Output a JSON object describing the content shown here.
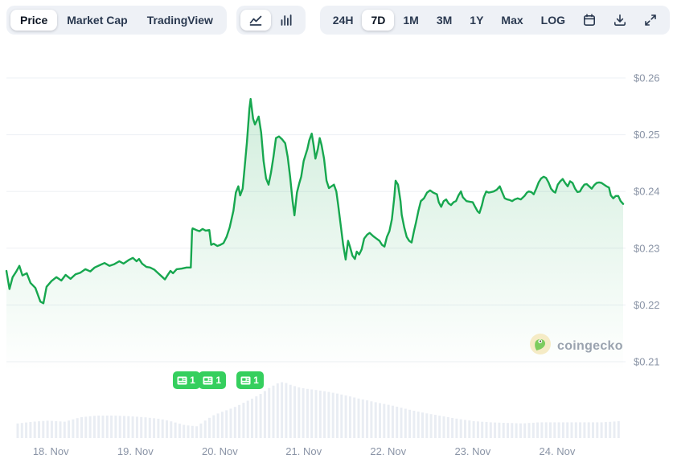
{
  "toolbar": {
    "metric_tabs": [
      {
        "label": "Price",
        "active": true
      },
      {
        "label": "Market Cap",
        "active": false
      },
      {
        "label": "TradingView",
        "active": false
      }
    ],
    "chart_type_buttons": [
      {
        "icon": "line-chart-icon",
        "active": true
      },
      {
        "icon": "bar-chart-icon",
        "active": false
      }
    ],
    "range_tabs": [
      {
        "label": "24H",
        "active": false
      },
      {
        "label": "7D",
        "active": true
      },
      {
        "label": "1M",
        "active": false
      },
      {
        "label": "3M",
        "active": false
      },
      {
        "label": "1Y",
        "active": false
      },
      {
        "label": "Max",
        "active": false
      },
      {
        "label": "LOG",
        "active": false
      }
    ],
    "action_buttons": [
      {
        "icon": "calendar-icon"
      },
      {
        "icon": "download-icon"
      },
      {
        "icon": "expand-icon"
      }
    ]
  },
  "watermark": {
    "text": "coingecko"
  },
  "news_badges": [
    {
      "count": "1",
      "x_frac": 0.287
    },
    {
      "count": "1",
      "x_frac": 0.329
    },
    {
      "count": "1",
      "x_frac": 0.39
    }
  ],
  "colors": {
    "line_green": "#17a74f",
    "area_green": "rgba(23,167,79,0.20)",
    "badge_green": "#35cf5e",
    "volume_bar": "#e9edf3",
    "grid": "#edf0f4",
    "axis_text": "#8a94a6",
    "toolbar_bg": "#eef1f6",
    "text_dark": "#16202e"
  },
  "chart_data": {
    "type": "line",
    "title": "Price (7D)",
    "currency": "USD",
    "legend": "none",
    "grid": "horizontal",
    "price_min_shown": 0.2203,
    "price_max_shown": 0.2563,
    "y_axis": {
      "ticks": [
        {
          "label": "$0.26",
          "value": 0.26
        },
        {
          "label": "$0.25",
          "value": 0.25
        },
        {
          "label": "$0.24",
          "value": 0.24
        },
        {
          "label": "$0.23",
          "value": 0.23
        },
        {
          "label": "$0.22",
          "value": 0.22
        },
        {
          "label": "$0.21",
          "value": 0.21
        }
      ]
    },
    "x_axis": {
      "ticks": [
        {
          "label": "18. Nov",
          "frac": 0.072
        },
        {
          "label": "19. Nov",
          "frac": 0.209
        },
        {
          "label": "20. Nov",
          "frac": 0.346
        },
        {
          "label": "21. Nov",
          "frac": 0.482
        },
        {
          "label": "22. Nov",
          "frac": 0.619
        },
        {
          "label": "23. Nov",
          "frac": 0.756
        },
        {
          "label": "24. Nov",
          "frac": 0.893
        }
      ]
    },
    "series": [
      {
        "name": "price_usd",
        "points": [
          [
            0.0,
            0.226
          ],
          [
            0.005,
            0.2228
          ],
          [
            0.01,
            0.2249
          ],
          [
            0.016,
            0.2259
          ],
          [
            0.021,
            0.2269
          ],
          [
            0.026,
            0.2252
          ],
          [
            0.033,
            0.2256
          ],
          [
            0.039,
            0.2239
          ],
          [
            0.047,
            0.223
          ],
          [
            0.055,
            0.2206
          ],
          [
            0.06,
            0.2203
          ],
          [
            0.065,
            0.2232
          ],
          [
            0.073,
            0.2242
          ],
          [
            0.081,
            0.2249
          ],
          [
            0.089,
            0.2243
          ],
          [
            0.096,
            0.2253
          ],
          [
            0.104,
            0.2246
          ],
          [
            0.112,
            0.2254
          ],
          [
            0.12,
            0.2257
          ],
          [
            0.128,
            0.2263
          ],
          [
            0.136,
            0.2259
          ],
          [
            0.143,
            0.2266
          ],
          [
            0.151,
            0.227
          ],
          [
            0.159,
            0.2274
          ],
          [
            0.167,
            0.2269
          ],
          [
            0.175,
            0.2272
          ],
          [
            0.183,
            0.2277
          ],
          [
            0.19,
            0.2273
          ],
          [
            0.198,
            0.2279
          ],
          [
            0.205,
            0.2283
          ],
          [
            0.211,
            0.2277
          ],
          [
            0.215,
            0.2281
          ],
          [
            0.22,
            0.2273
          ],
          [
            0.227,
            0.2267
          ],
          [
            0.233,
            0.2266
          ],
          [
            0.24,
            0.2262
          ],
          [
            0.246,
            0.2256
          ],
          [
            0.253,
            0.2249
          ],
          [
            0.257,
            0.2245
          ],
          [
            0.261,
            0.2252
          ],
          [
            0.266,
            0.226
          ],
          [
            0.27,
            0.2256
          ],
          [
            0.276,
            0.2263
          ],
          [
            0.284,
            0.2264
          ],
          [
            0.292,
            0.2266
          ],
          [
            0.299,
            0.2266
          ],
          [
            0.301,
            0.2331
          ],
          [
            0.302,
            0.2335
          ],
          [
            0.308,
            0.2332
          ],
          [
            0.313,
            0.233
          ],
          [
            0.318,
            0.2334
          ],
          [
            0.323,
            0.2331
          ],
          [
            0.329,
            0.2332
          ],
          [
            0.332,
            0.2306
          ],
          [
            0.336,
            0.2308
          ],
          [
            0.342,
            0.2304
          ],
          [
            0.347,
            0.2306
          ],
          [
            0.352,
            0.2309
          ],
          [
            0.357,
            0.232
          ],
          [
            0.362,
            0.2337
          ],
          [
            0.368,
            0.2366
          ],
          [
            0.372,
            0.2398
          ],
          [
            0.376,
            0.2409
          ],
          [
            0.379,
            0.2393
          ],
          [
            0.383,
            0.2405
          ],
          [
            0.386,
            0.244
          ],
          [
            0.39,
            0.2487
          ],
          [
            0.394,
            0.2546
          ],
          [
            0.396,
            0.2563
          ],
          [
            0.4,
            0.2528
          ],
          [
            0.403,
            0.2518
          ],
          [
            0.406,
            0.2525
          ],
          [
            0.409,
            0.2532
          ],
          [
            0.413,
            0.2504
          ],
          [
            0.417,
            0.2454
          ],
          [
            0.421,
            0.2423
          ],
          [
            0.425,
            0.2412
          ],
          [
            0.429,
            0.2433
          ],
          [
            0.433,
            0.2461
          ],
          [
            0.437,
            0.2494
          ],
          [
            0.442,
            0.2497
          ],
          [
            0.447,
            0.2492
          ],
          [
            0.452,
            0.2485
          ],
          [
            0.456,
            0.2461
          ],
          [
            0.46,
            0.2426
          ],
          [
            0.464,
            0.2383
          ],
          [
            0.467,
            0.2358
          ],
          [
            0.471,
            0.2398
          ],
          [
            0.475,
            0.2415
          ],
          [
            0.478,
            0.2426
          ],
          [
            0.482,
            0.2454
          ],
          [
            0.488,
            0.2475
          ],
          [
            0.491,
            0.249
          ],
          [
            0.495,
            0.2502
          ],
          [
            0.498,
            0.2482
          ],
          [
            0.501,
            0.2458
          ],
          [
            0.505,
            0.2475
          ],
          [
            0.508,
            0.2494
          ],
          [
            0.511,
            0.2482
          ],
          [
            0.515,
            0.2458
          ],
          [
            0.519,
            0.2419
          ],
          [
            0.523,
            0.2406
          ],
          [
            0.527,
            0.2409
          ],
          [
            0.531,
            0.2412
          ],
          [
            0.535,
            0.24
          ],
          [
            0.538,
            0.2376
          ],
          [
            0.542,
            0.2341
          ],
          [
            0.546,
            0.2306
          ],
          [
            0.55,
            0.228
          ],
          [
            0.554,
            0.2313
          ],
          [
            0.557,
            0.2303
          ],
          [
            0.561,
            0.2287
          ],
          [
            0.565,
            0.2281
          ],
          [
            0.568,
            0.2294
          ],
          [
            0.572,
            0.2289
          ],
          [
            0.576,
            0.2298
          ],
          [
            0.58,
            0.2317
          ],
          [
            0.585,
            0.2324
          ],
          [
            0.589,
            0.2327
          ],
          [
            0.595,
            0.2321
          ],
          [
            0.6,
            0.2317
          ],
          [
            0.605,
            0.2313
          ],
          [
            0.609,
            0.2306
          ],
          [
            0.613,
            0.2303
          ],
          [
            0.617,
            0.232
          ],
          [
            0.621,
            0.233
          ],
          [
            0.625,
            0.2351
          ],
          [
            0.629,
            0.239
          ],
          [
            0.631,
            0.2419
          ],
          [
            0.635,
            0.2412
          ],
          [
            0.639,
            0.2383
          ],
          [
            0.641,
            0.2359
          ],
          [
            0.645,
            0.2337
          ],
          [
            0.649,
            0.232
          ],
          [
            0.653,
            0.2313
          ],
          [
            0.657,
            0.231
          ],
          [
            0.661,
            0.2331
          ],
          [
            0.664,
            0.2345
          ],
          [
            0.668,
            0.2366
          ],
          [
            0.672,
            0.2383
          ],
          [
            0.677,
            0.2388
          ],
          [
            0.682,
            0.2398
          ],
          [
            0.687,
            0.2402
          ],
          [
            0.692,
            0.2398
          ],
          [
            0.698,
            0.2395
          ],
          [
            0.701,
            0.2381
          ],
          [
            0.705,
            0.2373
          ],
          [
            0.709,
            0.2383
          ],
          [
            0.713,
            0.2386
          ],
          [
            0.717,
            0.2379
          ],
          [
            0.721,
            0.2376
          ],
          [
            0.725,
            0.2381
          ],
          [
            0.729,
            0.2383
          ],
          [
            0.733,
            0.2393
          ],
          [
            0.737,
            0.24
          ],
          [
            0.74,
            0.239
          ],
          [
            0.746,
            0.2383
          ],
          [
            0.751,
            0.2382
          ],
          [
            0.756,
            0.2381
          ],
          [
            0.76,
            0.2373
          ],
          [
            0.764,
            0.2365
          ],
          [
            0.767,
            0.2362
          ],
          [
            0.771,
            0.2376
          ],
          [
            0.774,
            0.239
          ],
          [
            0.778,
            0.24
          ],
          [
            0.782,
            0.2398
          ],
          [
            0.786,
            0.2399
          ],
          [
            0.79,
            0.24
          ],
          [
            0.795,
            0.2403
          ],
          [
            0.8,
            0.2409
          ],
          [
            0.804,
            0.2398
          ],
          [
            0.808,
            0.2388
          ],
          [
            0.812,
            0.2386
          ],
          [
            0.816,
            0.2385
          ],
          [
            0.82,
            0.2383
          ],
          [
            0.824,
            0.2386
          ],
          [
            0.829,
            0.2388
          ],
          [
            0.834,
            0.2386
          ],
          [
            0.84,
            0.2392
          ],
          [
            0.844,
            0.2398
          ],
          [
            0.847,
            0.24
          ],
          [
            0.851,
            0.2399
          ],
          [
            0.855,
            0.2395
          ],
          [
            0.859,
            0.2405
          ],
          [
            0.863,
            0.2416
          ],
          [
            0.867,
            0.2423
          ],
          [
            0.871,
            0.2426
          ],
          [
            0.875,
            0.2424
          ],
          [
            0.879,
            0.2416
          ],
          [
            0.883,
            0.2405
          ],
          [
            0.887,
            0.24
          ],
          [
            0.89,
            0.2398
          ],
          [
            0.894,
            0.2412
          ],
          [
            0.898,
            0.2418
          ],
          [
            0.902,
            0.2422
          ],
          [
            0.906,
            0.2415
          ],
          [
            0.91,
            0.2409
          ],
          [
            0.914,
            0.2418
          ],
          [
            0.918,
            0.2415
          ],
          [
            0.922,
            0.2405
          ],
          [
            0.926,
            0.2399
          ],
          [
            0.93,
            0.24
          ],
          [
            0.933,
            0.2406
          ],
          [
            0.937,
            0.2412
          ],
          [
            0.941,
            0.2413
          ],
          [
            0.945,
            0.2409
          ],
          [
            0.949,
            0.2405
          ],
          [
            0.953,
            0.2411
          ],
          [
            0.957,
            0.2415
          ],
          [
            0.961,
            0.2416
          ],
          [
            0.965,
            0.2415
          ],
          [
            0.969,
            0.2412
          ],
          [
            0.973,
            0.2409
          ],
          [
            0.977,
            0.2407
          ],
          [
            0.98,
            0.2393
          ],
          [
            0.984,
            0.2388
          ],
          [
            0.988,
            0.2392
          ],
          [
            0.992,
            0.2392
          ],
          [
            0.996,
            0.2383
          ],
          [
            1.0,
            0.2378
          ]
        ]
      }
    ],
    "volume_profile": [
      [
        0.018,
        0.26
      ],
      [
        0.042,
        0.29
      ],
      [
        0.068,
        0.31
      ],
      [
        0.094,
        0.29
      ],
      [
        0.12,
        0.37
      ],
      [
        0.146,
        0.4
      ],
      [
        0.172,
        0.4
      ],
      [
        0.198,
        0.39
      ],
      [
        0.224,
        0.37
      ],
      [
        0.25,
        0.34
      ],
      [
        0.27,
        0.29
      ],
      [
        0.289,
        0.23
      ],
      [
        0.309,
        0.21
      ],
      [
        0.322,
        0.31
      ],
      [
        0.335,
        0.4
      ],
      [
        0.348,
        0.46
      ],
      [
        0.361,
        0.51
      ],
      [
        0.374,
        0.57
      ],
      [
        0.387,
        0.64
      ],
      [
        0.4,
        0.71
      ],
      [
        0.413,
        0.79
      ],
      [
        0.426,
        0.89
      ],
      [
        0.439,
        0.97
      ],
      [
        0.449,
        1.0
      ],
      [
        0.462,
        0.94
      ],
      [
        0.478,
        0.89
      ],
      [
        0.498,
        0.86
      ],
      [
        0.518,
        0.83
      ],
      [
        0.537,
        0.79
      ],
      [
        0.557,
        0.74
      ],
      [
        0.576,
        0.69
      ],
      [
        0.602,
        0.63
      ],
      [
        0.629,
        0.57
      ],
      [
        0.655,
        0.5
      ],
      [
        0.681,
        0.44
      ],
      [
        0.707,
        0.39
      ],
      [
        0.733,
        0.34
      ],
      [
        0.759,
        0.3
      ],
      [
        0.785,
        0.28
      ],
      [
        0.811,
        0.27
      ],
      [
        0.837,
        0.26
      ],
      [
        0.863,
        0.28
      ],
      [
        0.889,
        0.28
      ],
      [
        0.915,
        0.28
      ],
      [
        0.941,
        0.28
      ],
      [
        0.967,
        0.28
      ],
      [
        0.993,
        0.3
      ]
    ]
  }
}
